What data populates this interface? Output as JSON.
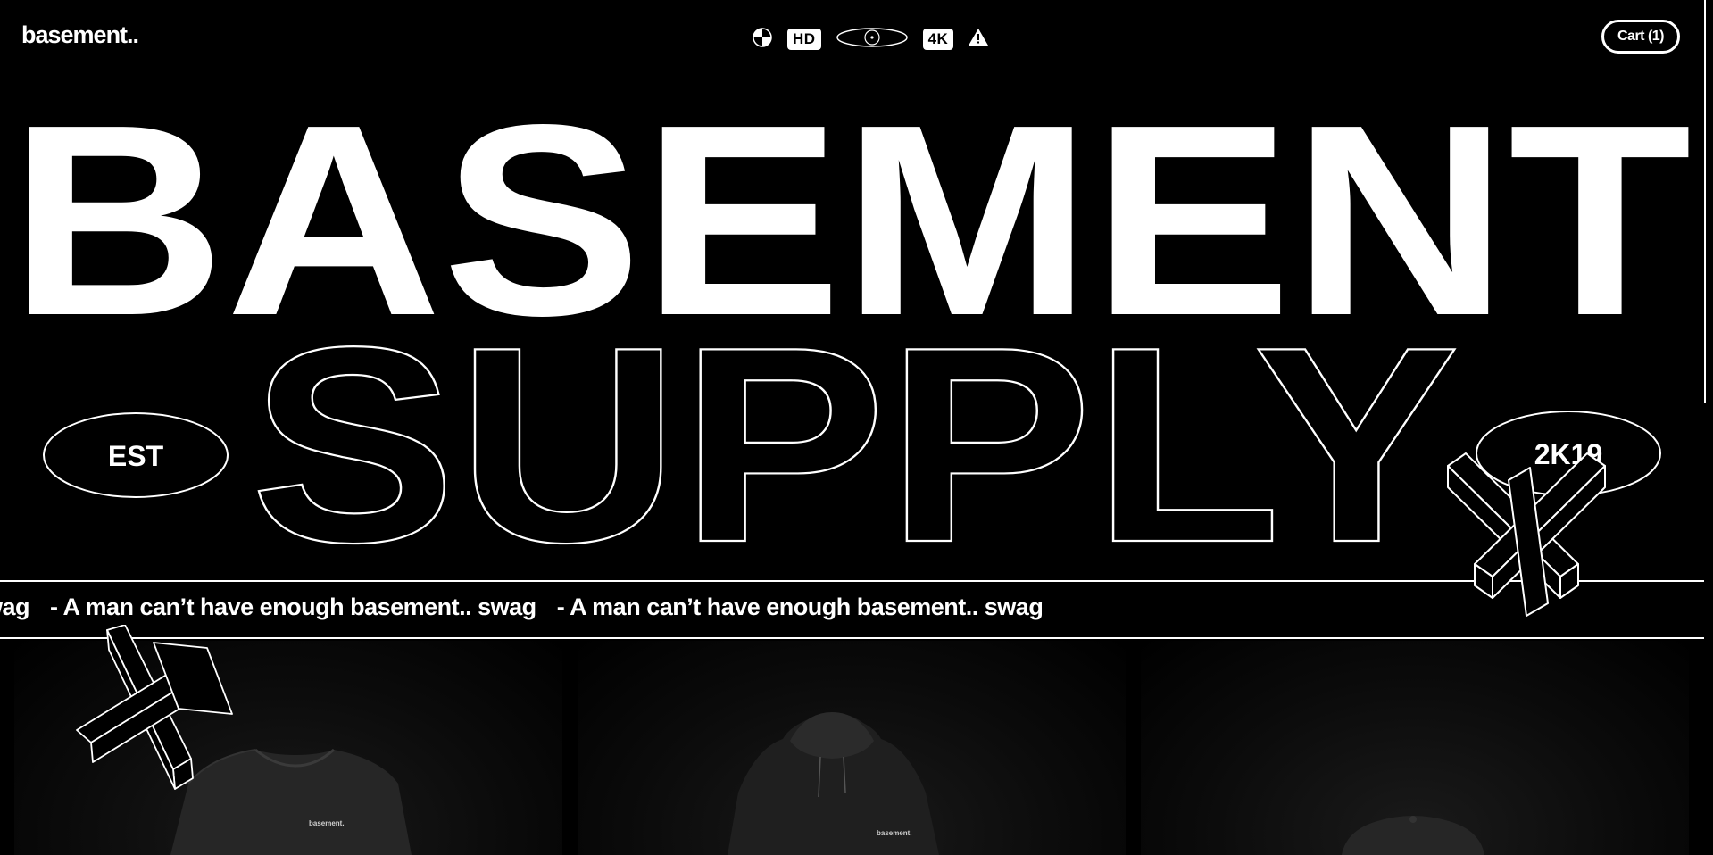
{
  "header": {
    "logo": "basement..",
    "badges": [
      {
        "type": "icon",
        "name": "contrast-icon"
      },
      {
        "type": "text",
        "label": "HD"
      },
      {
        "type": "icon",
        "name": "disc-icon"
      },
      {
        "type": "text",
        "label": "4K"
      },
      {
        "type": "icon",
        "name": "warning-icon"
      }
    ],
    "cart_label": "Cart (1)"
  },
  "hero": {
    "line1": "BASEMENT",
    "line2": "SUPPLY",
    "est_label": "EST",
    "year_label": "2K19"
  },
  "marquee": {
    "items": [
      "wag",
      "- A man can’t have enough basement.. swag",
      "- A man can’t have enough basement.. swag"
    ]
  },
  "products": [
    {
      "name": "t-shirt",
      "label": "basement."
    },
    {
      "name": "hoodie",
      "label": "basement."
    },
    {
      "name": "cap",
      "label": ""
    }
  ],
  "colors": {
    "background": "#000000",
    "foreground": "#ffffff"
  }
}
